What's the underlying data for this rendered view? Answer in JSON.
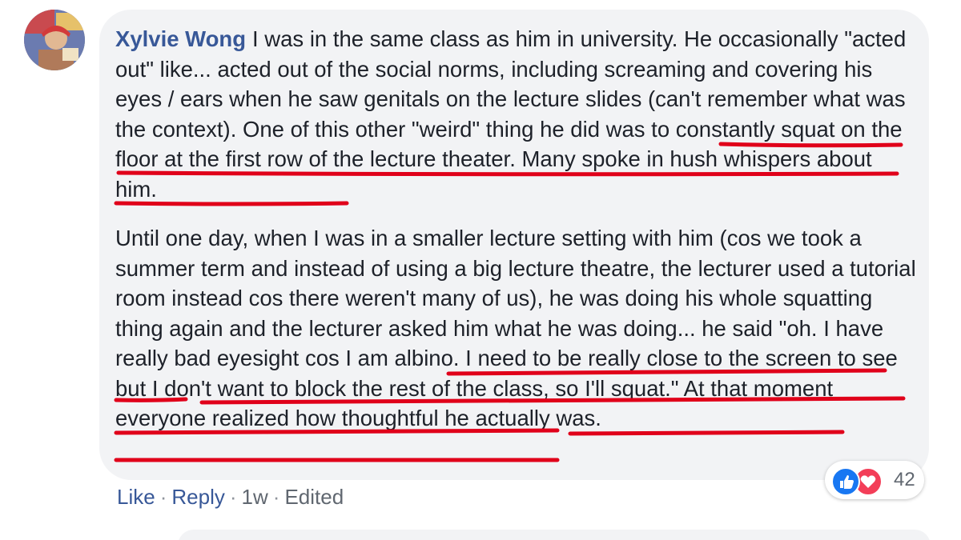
{
  "comment": {
    "author": "Xylvie Wong",
    "paragraph1": "I was in the same class as him in university. He occasionally \"acted out\" like... acted out of the social norms, including screaming and covering his eyes / ears when he saw genitals on the lecture slides (can't remember what was the context). One of this other \"weird\" thing he did was to constantly squat on the floor at the first row of the lecture theater. Many spoke in hush whispers about him.",
    "paragraph2": "Until one day, when I was in a smaller lecture setting with him (cos we took a summer term and instead of using a big lecture theatre, the lecturer used a tutorial room instead cos there weren't many of us), he was doing his whole squatting thing again and the lecturer asked him what he was doing... he said \"oh. I have really bad eyesight cos I am albino. I need to be really close to the screen to see but I don't want to block the rest of the class, so I'll squat.\" At that moment everyone realized how thoughtful he actually was."
  },
  "actions": {
    "like": "Like",
    "reply": "Reply",
    "time": "1w",
    "edited": "Edited",
    "separator": "·"
  },
  "reactions": {
    "icons": [
      "like-icon",
      "love-icon"
    ],
    "count": "42"
  },
  "colors": {
    "author": "#385898",
    "text": "#1d2129",
    "bubble": "#f2f3f5",
    "link": "#385898",
    "underline": "#e0001a",
    "like": "#1877f2",
    "love": "#f33e58"
  }
}
